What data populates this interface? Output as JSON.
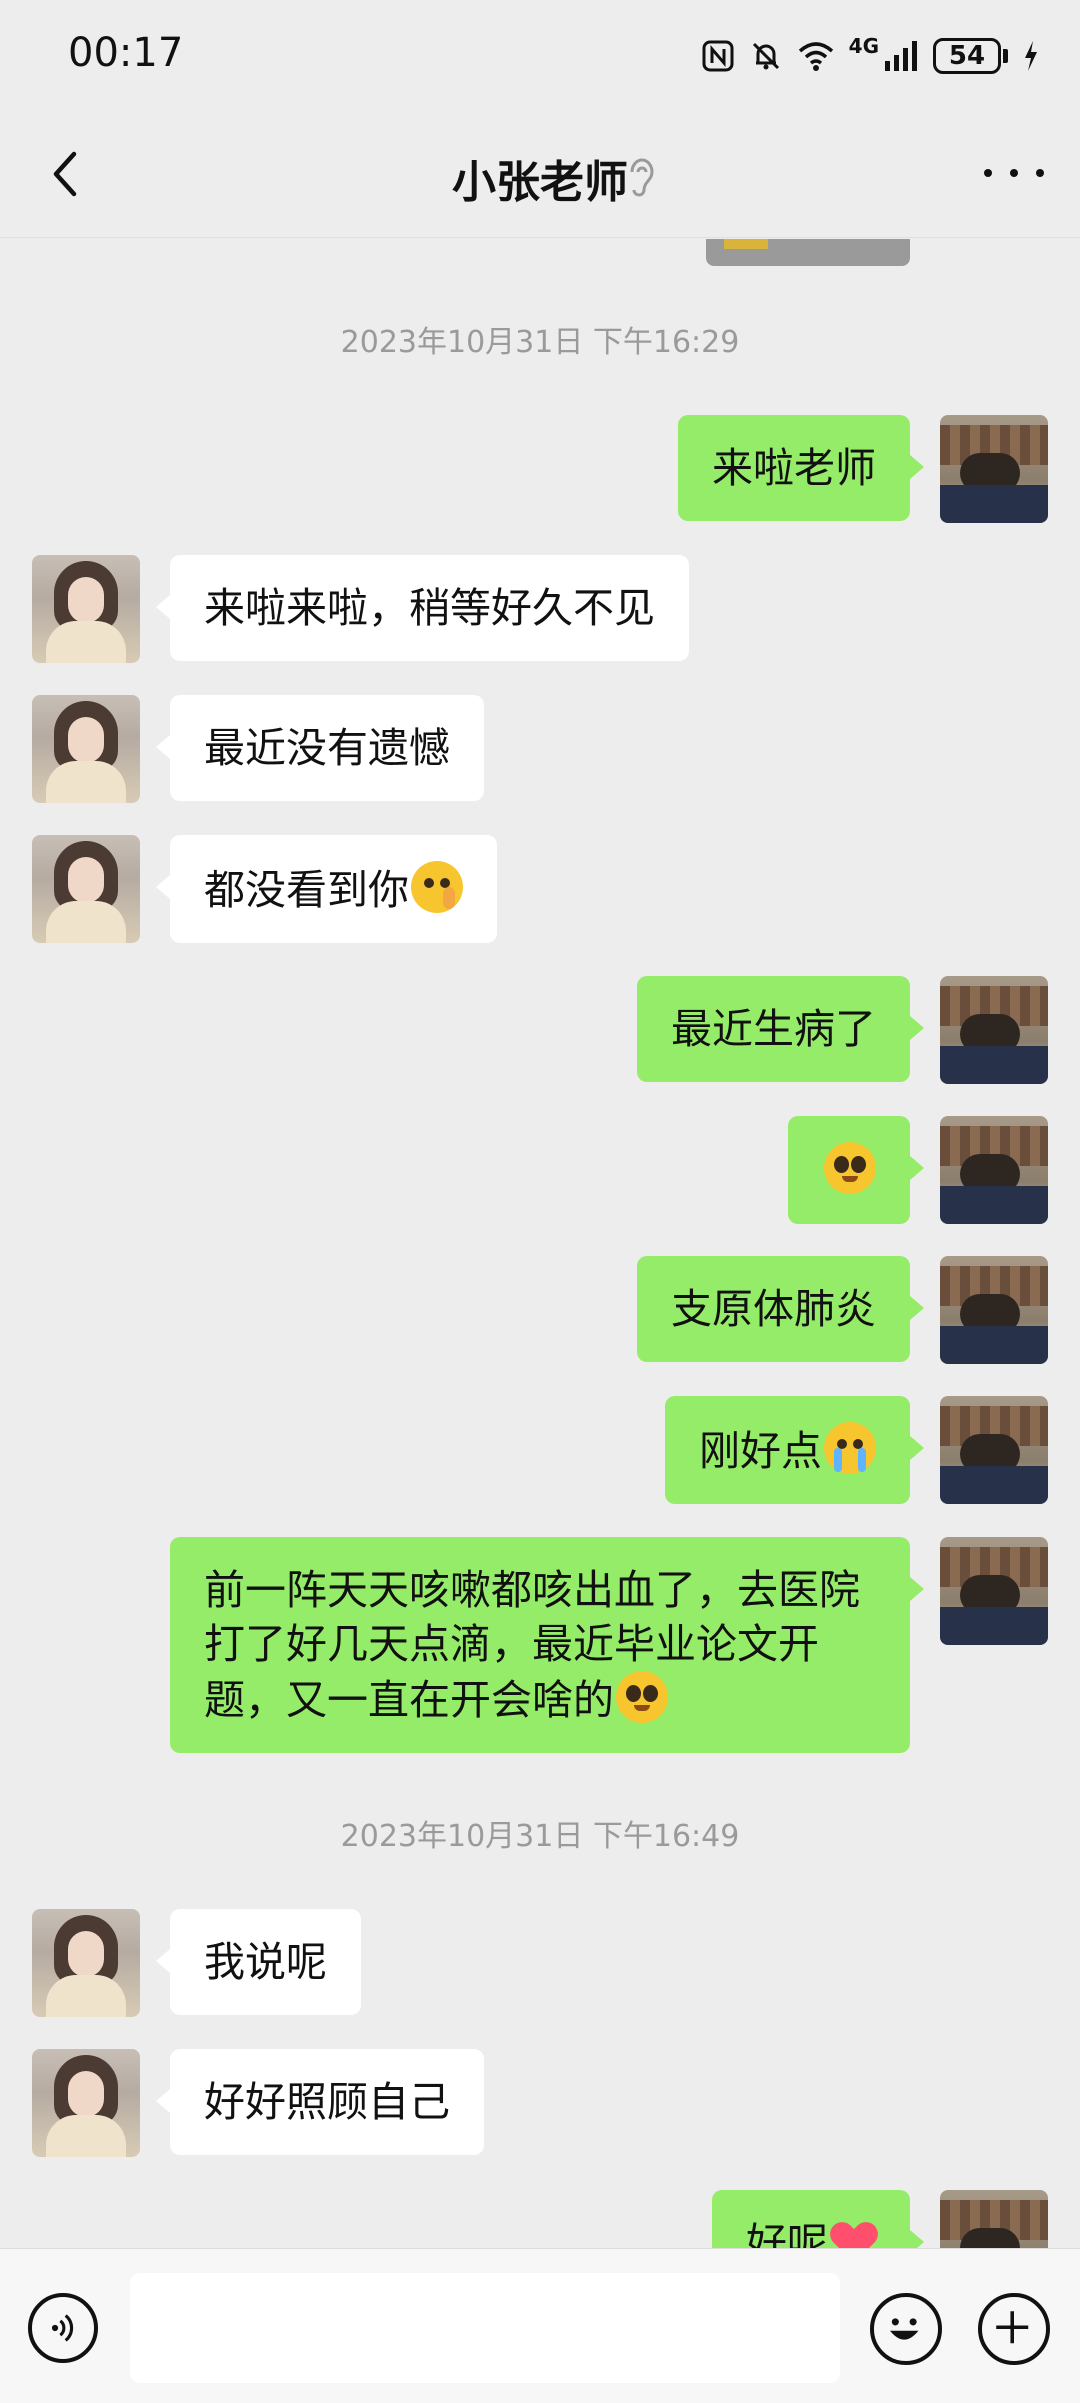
{
  "status_bar": {
    "time": "00:17",
    "network_label": "4G",
    "battery_level": "54",
    "icons": [
      "nfc-icon",
      "mute-icon",
      "wifi-icon",
      "signal-icon",
      "battery-icon",
      "charging-icon"
    ]
  },
  "header": {
    "title": "小张老师",
    "back_icon": "chevron-left-icon",
    "status_icon": "ear-icon",
    "more_icon": "more-icon"
  },
  "conversation": {
    "timestamps": [
      "2023年10月31日 下午16:29",
      "2023年10月31日 下午16:49"
    ],
    "messages": [
      {
        "side": "out",
        "text": "来啦老师"
      },
      {
        "side": "in",
        "text": "来啦来啦，稍等好久不见"
      },
      {
        "side": "in",
        "text": "最近没有遗憾"
      },
      {
        "side": "in",
        "text": "都没看到你",
        "emoji": "shushing-emoji"
      },
      {
        "side": "out",
        "text": "最近生病了"
      },
      {
        "side": "out",
        "text": "",
        "emoji": "pleading-emoji"
      },
      {
        "side": "out",
        "text": "支原体肺炎"
      },
      {
        "side": "out",
        "text": "刚好点",
        "emoji": "crying-emoji"
      },
      {
        "side": "out",
        "text": "前一阵天天咳嗽都咳出血了，去医院打了好几天点滴，最近毕业论文开题，又一直在开会啥的",
        "emoji": "pleading-emoji"
      },
      {
        "side": "in",
        "text": "我说呢"
      },
      {
        "side": "in",
        "text": "好好照顾自己"
      },
      {
        "side": "out",
        "text": "好呢",
        "emoji": "heart-emoji"
      }
    ]
  },
  "input_bar": {
    "voice_icon": "voice-icon",
    "input_value": "",
    "emoji_icon": "smiley-icon",
    "plus_icon": "plus-icon"
  },
  "colors": {
    "background": "#ededed",
    "outgoing_bubble": "#95ec69",
    "incoming_bubble": "#ffffff",
    "timestamp": "#9a9a9a"
  }
}
